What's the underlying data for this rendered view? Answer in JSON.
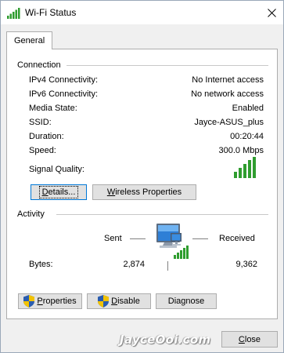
{
  "window": {
    "title": "Wi-Fi Status",
    "icon": "wifi-signal-icon"
  },
  "tabs": [
    {
      "label": "General"
    }
  ],
  "connection": {
    "heading": "Connection",
    "rows": [
      {
        "label": "IPv4 Connectivity:",
        "value": "No Internet access"
      },
      {
        "label": "IPv6 Connectivity:",
        "value": "No network access"
      },
      {
        "label": "Media State:",
        "value": "Enabled"
      },
      {
        "label": "SSID:",
        "value": "Jayce-ASUS_plus"
      },
      {
        "label": "Duration:",
        "value": "00:20:44"
      },
      {
        "label": "Speed:",
        "value": "300.0 Mbps"
      }
    ],
    "signal_label": "Signal Quality:",
    "signal_bars": 5,
    "signal_bars_total": 5,
    "details_button": {
      "prefix": "D",
      "rest": "etails..."
    },
    "wireless_button": {
      "prefix": "W",
      "rest": "ireless Properties"
    }
  },
  "activity": {
    "heading": "Activity",
    "sent_label": "Sent",
    "received_label": "Received",
    "bytes_label": "Bytes:",
    "bytes_sent": "2,874",
    "bytes_received": "9,362"
  },
  "actions": {
    "properties": {
      "prefix": "P",
      "rest": "roperties"
    },
    "disable": {
      "prefix": "D",
      "rest": "isable"
    },
    "diagnose": {
      "prefix": "",
      "rest": "Diagnose"
    }
  },
  "footer": {
    "watermark": "JayceOoi.com",
    "close": {
      "prefix": "C",
      "rest": "lose"
    }
  },
  "colors": {
    "signal_green": "#2f9d2f",
    "accent_blue": "#0078d7",
    "shield_blue": "#2a5db0",
    "shield_yellow": "#f2c200"
  }
}
